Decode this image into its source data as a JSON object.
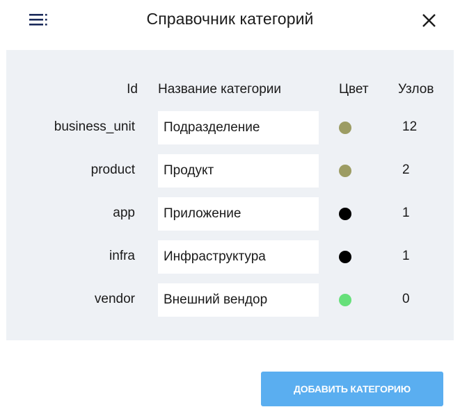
{
  "header": {
    "title": "Справочник категорий",
    "menu_icon": "menu-lines-dots-icon",
    "close_icon": "close-icon"
  },
  "table": {
    "columns": {
      "id": "Id",
      "name": "Название категории",
      "color": "Цвет",
      "count": "Узлов"
    },
    "rows": [
      {
        "id": "business_unit",
        "name": "Подразделение",
        "color": "#9c9c63",
        "count": "12"
      },
      {
        "id": "product",
        "name": "Продукт",
        "color": "#9c9c63",
        "count": "2"
      },
      {
        "id": "app",
        "name": "Приложение",
        "color": "#000000",
        "count": "1"
      },
      {
        "id": "infra",
        "name": "Инфраструктура",
        "color": "#000000",
        "count": "1"
      },
      {
        "id": "vendor",
        "name": "Внешний вендор",
        "color": "#66e07a",
        "count": "0"
      }
    ]
  },
  "footer": {
    "add_label": "ДОБАВИТЬ КАТЕГОРИЮ"
  },
  "colors": {
    "panel_bg": "#eef1f5",
    "button_bg": "#5aaef0"
  }
}
